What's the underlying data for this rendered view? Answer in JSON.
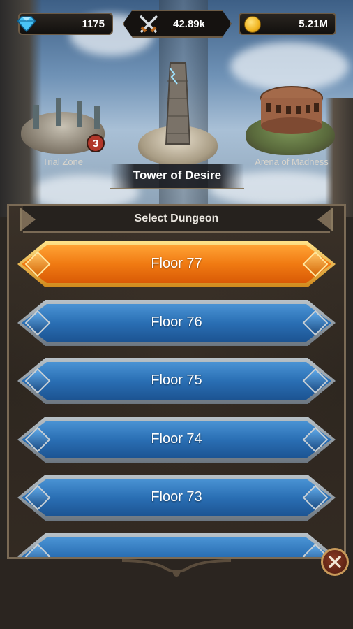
{
  "resources": {
    "gems": "1175",
    "power": "42.89k",
    "gold": "5.21M"
  },
  "locations": {
    "left": {
      "label": "Trial Zone",
      "badge": "3"
    },
    "center": {
      "label": "Tower of Desire"
    },
    "right": {
      "label": "Arena of Madness"
    }
  },
  "panel": {
    "title": "Select Dungeon",
    "floors": [
      {
        "label": "Floor 77",
        "selected": true
      },
      {
        "label": "Floor 76",
        "selected": false
      },
      {
        "label": "Floor 75",
        "selected": false
      },
      {
        "label": "Floor 74",
        "selected": false
      },
      {
        "label": "Floor 73",
        "selected": false
      },
      {
        "label": "",
        "selected": false
      }
    ]
  },
  "icons": {
    "gem": "gem-icon",
    "power": "crossed-swords-icon",
    "gold": "coin-icon",
    "close": "close-icon"
  },
  "colors": {
    "selected_floor": "#f07a12",
    "floor": "#2a6fb4",
    "panel_border": "#7a6a55"
  }
}
